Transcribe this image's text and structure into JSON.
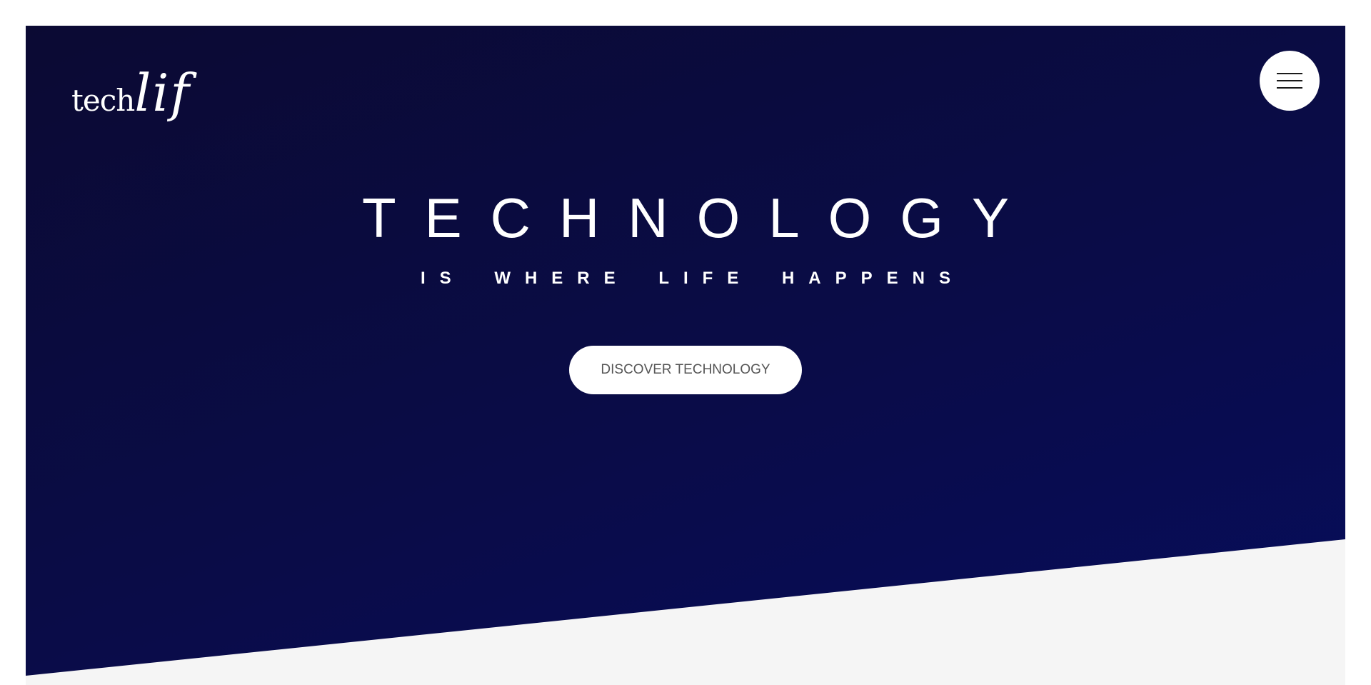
{
  "header": {
    "logo": {
      "part1": "tech",
      "part2": "lif"
    },
    "menu_icon": "hamburger-menu-icon"
  },
  "hero": {
    "title": "TECHNOLOGY",
    "subtitle": "IS WHERE LIFE HAPPENS",
    "cta_label": "DISCOVER TECHNOLOGY"
  },
  "colors": {
    "hero_gradient_start": "#0b0a33",
    "hero_gradient_end": "#060d5c",
    "text_on_dark": "#ffffff",
    "button_bg": "#ffffff",
    "button_text": "#555555",
    "section_below": "#f5f5f5"
  }
}
